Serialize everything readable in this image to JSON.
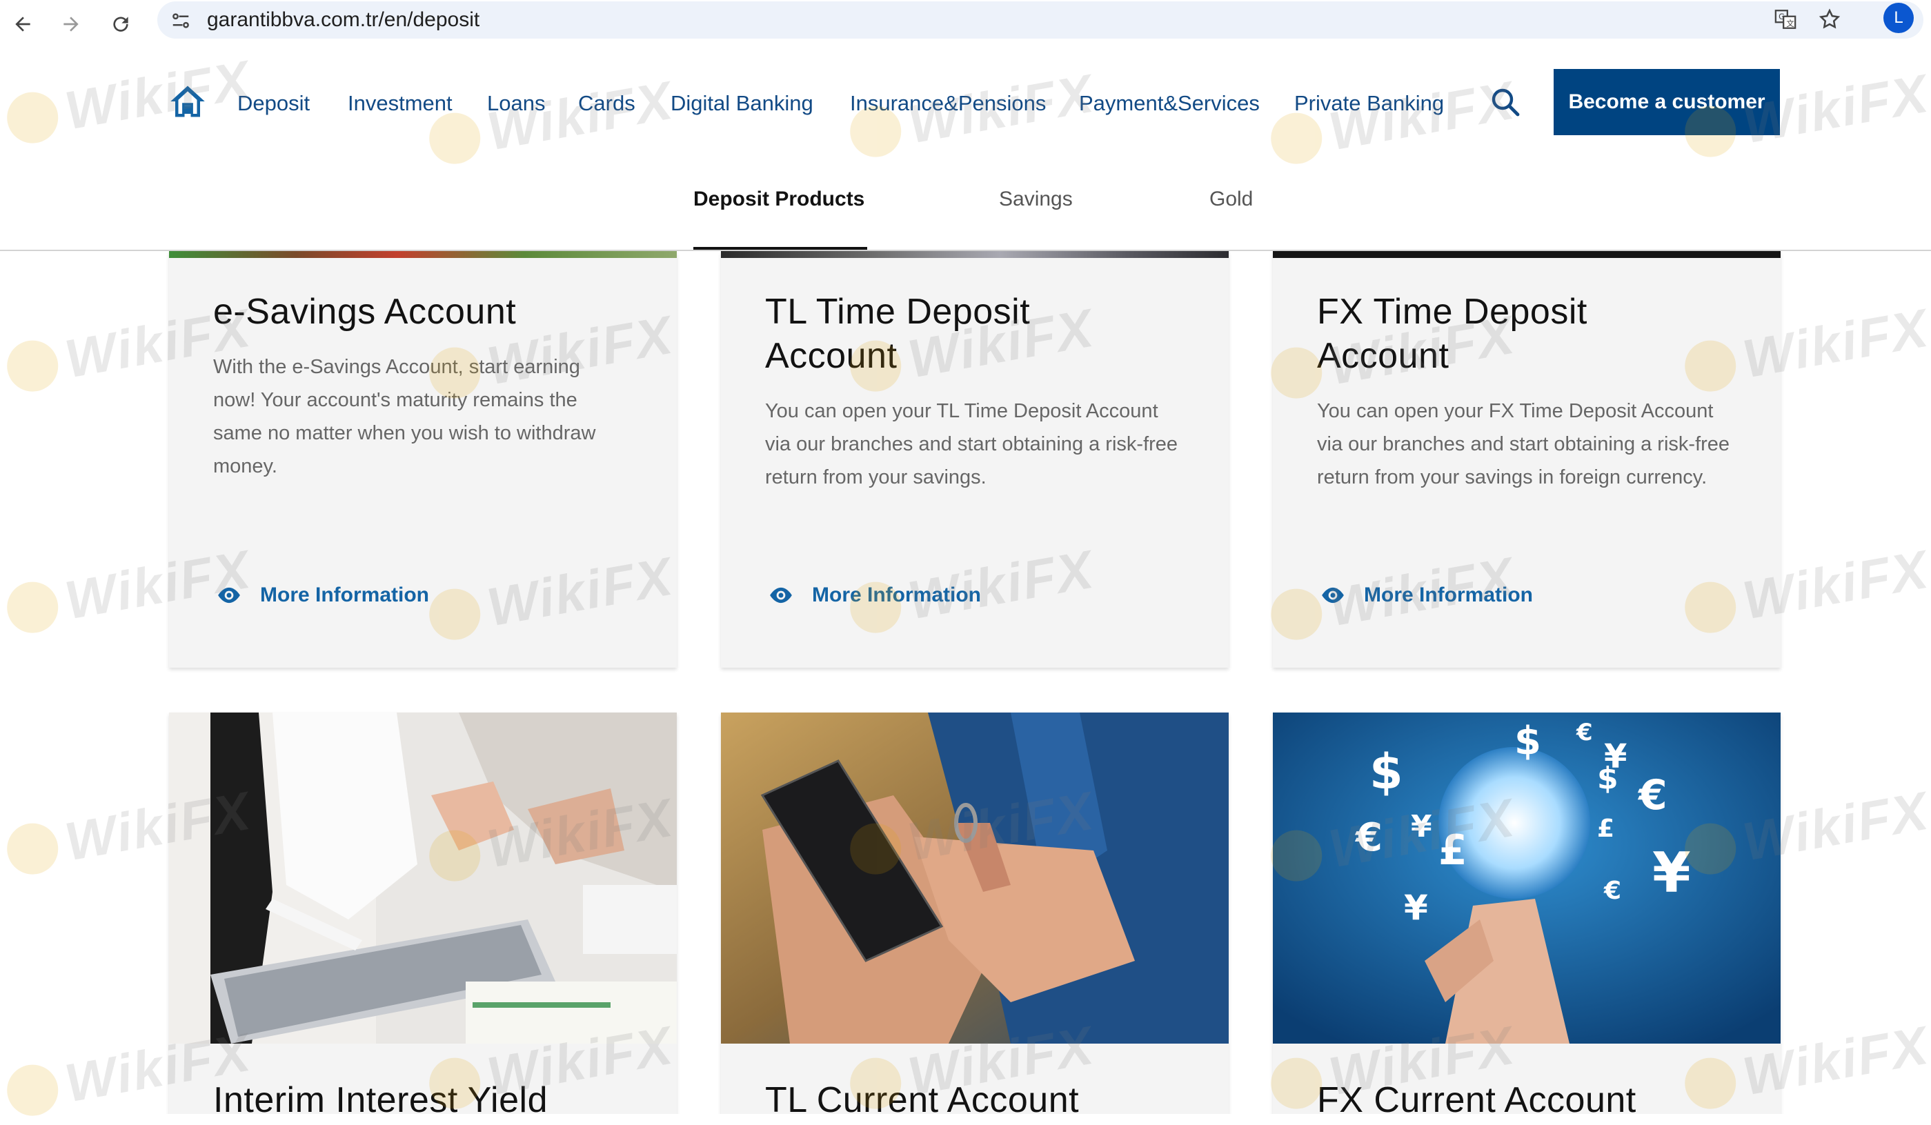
{
  "browser": {
    "url": "garantibbva.com.tr/en/deposit",
    "profile_initial": "L"
  },
  "nav": {
    "items": [
      {
        "label": "Deposit"
      },
      {
        "label": "Investment"
      },
      {
        "label": "Loans"
      },
      {
        "label": "Cards"
      },
      {
        "label": "Digital Banking"
      },
      {
        "label": "Insurance&Pensions"
      },
      {
        "label": "Payment&Services"
      },
      {
        "label": "Private Banking"
      }
    ],
    "cta_label": "Become a customer"
  },
  "tabs": {
    "items": [
      {
        "label": "Deposit Products",
        "active": true
      },
      {
        "label": "Savings",
        "active": false
      },
      {
        "label": "Gold",
        "active": false
      }
    ]
  },
  "cards": [
    {
      "title": "e-Savings Account",
      "description": "With the e-Savings Account, start earning now! Your account's maturity remains the same no matter when you wish to withdraw money.",
      "link_label": "More Information"
    },
    {
      "title": "TL Time Deposit Account",
      "description": "You can open your TL Time Deposit Account via our branches and start obtaining a risk-free return from your savings.",
      "link_label": "More Information"
    },
    {
      "title": "FX Time Deposit Account",
      "description": "You can open your FX Time Deposit Account via our branches and start obtaining a risk-free return from your savings in foreign currency.",
      "link_label": "More Information"
    }
  ],
  "second_row": [
    {
      "title": "Interim Interest Yield",
      "image_icon": "tablet-meeting-photo"
    },
    {
      "title": "TL Current Account",
      "image_icon": "smartphone-hand-photo"
    },
    {
      "title": "FX Current Account",
      "image_icon": "currency-globe-photo"
    }
  ],
  "watermark": {
    "text": "WikiFX"
  },
  "colors": {
    "brand_dark": "#004481",
    "nav_text": "#124a85",
    "link": "#1464a5",
    "card_bg": "#f4f4f4"
  }
}
